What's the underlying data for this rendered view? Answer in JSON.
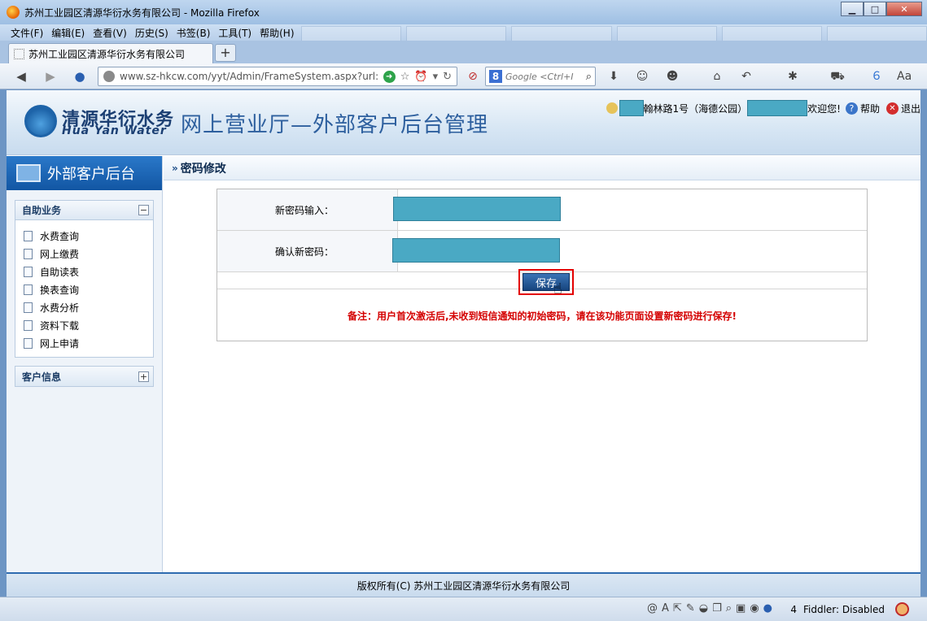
{
  "window": {
    "title": "苏州工业园区清源华衍水务有限公司 - Mozilla Firefox",
    "controls": {
      "minimize": "▁",
      "maximize": "□",
      "close": "✕"
    }
  },
  "menu": [
    "文件(F)",
    "编辑(E)",
    "查看(V)",
    "历史(S)",
    "书签(B)",
    "工具(T)",
    "帮助(H)"
  ],
  "tab": {
    "label": "苏州工业园区清源华衍水务有限公司",
    "new_tab": "+"
  },
  "nav": {
    "url": "www.sz-hkcw.com/yyt/Admin/FrameSystem.aspx?url:",
    "search_placeholder": "Google <Ctrl+I",
    "search_engine_letter": "8"
  },
  "header": {
    "logo_cn": "清源华衍水务",
    "logo_en": "Hua Yan Water",
    "system_title": "网上营业厅—外部客户后台管理",
    "user_address": "翰林路1号（海德公园）",
    "welcome": "欢迎您!",
    "help": "帮助",
    "exit": "退出"
  },
  "sidebar": {
    "title": "外部客户后台",
    "panels": [
      {
        "title": "自助业务",
        "toggle": "−",
        "items": [
          "水费查询",
          "网上缴费",
          "自助读表",
          "换表查询",
          "水费分析",
          "资料下载",
          "网上申请"
        ]
      },
      {
        "title": "客户信息",
        "toggle": "+"
      }
    ]
  },
  "main": {
    "breadcrumb": "密码修改",
    "form": {
      "new_password_label": "新密码输入：",
      "confirm_password_label": "确认新密码：",
      "save_label": "保存",
      "note": "备注：用户首次激活后,未收到短信通知的初始密码，请在该功能页面设置新密码进行保存!"
    }
  },
  "footer": {
    "copyright": "版权所有(C)  苏州工业园区清源华衍水务有限公司"
  },
  "status": {
    "count": "4",
    "fiddler": "Fiddler: Disabled"
  },
  "colors": {
    "accent": "#1256a3",
    "redaction": "#4aa9c4",
    "note_red": "#d40000",
    "highlight_red": "#e30000"
  }
}
